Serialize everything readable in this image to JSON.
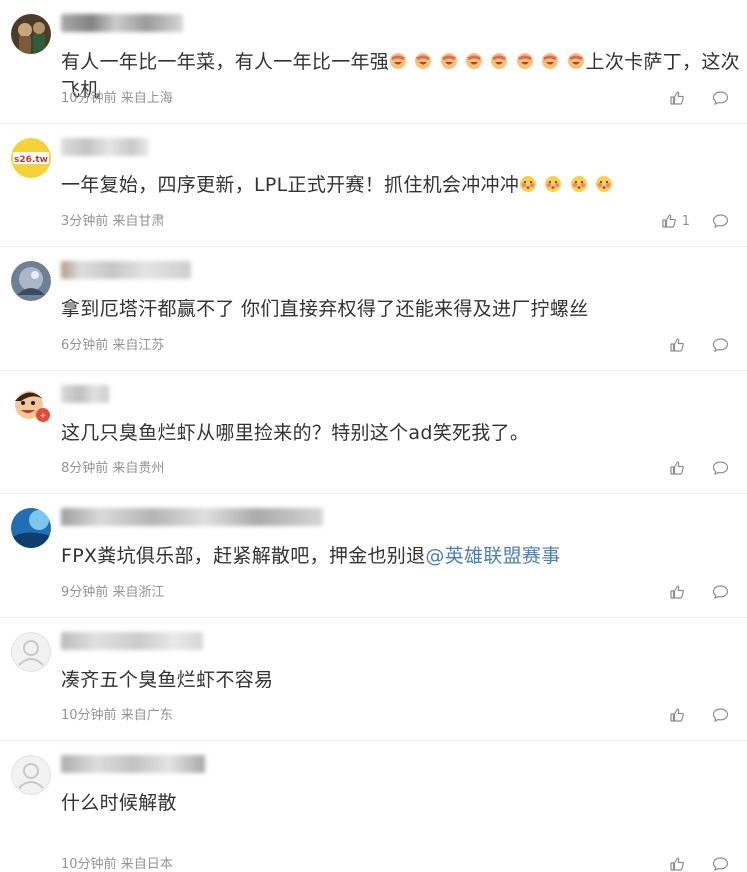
{
  "comments": [
    {
      "text_parts": [
        "有人一年比一年菜，有人一年比一年强",
        "上次卡萨丁，这次飞机"
      ],
      "emoji_count": 8,
      "time": "10分钟前",
      "location": "来自上海",
      "like_count": ""
    },
    {
      "text_parts": [
        "一年复始，四序更新，LPL正式开赛！抓住机会冲冲冲"
      ],
      "emoji_count": 4,
      "time": "3分钟前",
      "location": "来自甘肃",
      "like_count": "1",
      "avatar_text": "s26.tw"
    },
    {
      "text_parts": [
        "拿到厄塔汗都赢不了 你们直接弃权得了还能来得及进厂拧螺丝"
      ],
      "time": "6分钟前",
      "location": "来自江苏",
      "like_count": ""
    },
    {
      "text_parts": [
        "这几只臭鱼烂虾从哪里捡来的？特别这个ad笑死我了。"
      ],
      "time": "8分钟前",
      "location": "来自贵州",
      "like_count": ""
    },
    {
      "text_parts": [
        "FPX粪坑俱乐部，赶紧解散吧，押金也别退"
      ],
      "mention": "@英雄联盟赛事",
      "time": "9分钟前",
      "location": "来自浙江",
      "like_count": ""
    },
    {
      "text_parts": [
        "凑齐五个臭鱼烂虾不容易"
      ],
      "time": "10分钟前",
      "location": "来自广东",
      "like_count": ""
    },
    {
      "text_parts": [
        "什么时候解散"
      ],
      "time": "10分钟前",
      "location": "来自日本",
      "like_count": ""
    }
  ],
  "icons": {
    "like": "thumbs-up-icon",
    "reply": "comment-bubble-icon"
  },
  "colors": {
    "text": "#333333",
    "meta": "#939393",
    "mention": "#4a7fb6",
    "divider": "#eeeeee"
  }
}
